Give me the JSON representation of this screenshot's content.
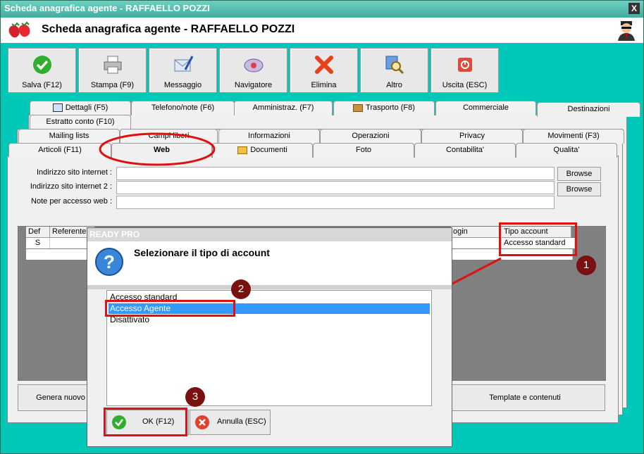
{
  "window": {
    "title": "Scheda anagrafica agente - RAFFAELLO POZZI",
    "close_label": "X"
  },
  "header": {
    "title": "Scheda anagrafica agente - RAFFAELLO POZZI",
    "logo_icon": "strawberry-icon",
    "agent_icon": "agent-avatar-icon"
  },
  "toolbar": [
    {
      "label": "Salva (F12)",
      "icon": "check-icon"
    },
    {
      "label": "Stampa (F9)",
      "icon": "printer-icon"
    },
    {
      "label": "Messaggio",
      "icon": "message-icon"
    },
    {
      "label": "Navigatore",
      "icon": "compass-icon"
    },
    {
      "label": "Elimina",
      "icon": "delete-icon"
    },
    {
      "label": "Altro",
      "icon": "search-icon"
    },
    {
      "label": "Uscita (ESC)",
      "icon": "exit-icon"
    }
  ],
  "tabs": {
    "row1": [
      "Dettagli (F5)",
      "Telefono/note (F6)",
      "Amministraz. (F7)",
      "Trasporto (F8)",
      "Commerciale",
      "Destinazioni"
    ],
    "row2": [
      "Estratto conto (F10)"
    ],
    "row3": [
      "Mailing lists",
      "Campi liberi",
      "Informazioni",
      "Operazioni",
      "Privacy",
      "Movimenti (F3)"
    ],
    "row4": [
      "Articoli (F11)",
      "Web",
      "Documenti",
      "Foto",
      "Contabilita'",
      "Qualita'"
    ],
    "active": "Web"
  },
  "form": {
    "site_label": "Indirizzo sito internet :",
    "site_value": "",
    "site2_label": "Indirizzo sito internet 2 :",
    "site2_value": "",
    "notes_label": "Note per accesso web :",
    "notes_value": "",
    "browse_label": "Browse"
  },
  "grid": {
    "headers": [
      "Def",
      "Referente",
      "ogin",
      "Tipo account"
    ],
    "row": {
      "def": "S",
      "tipo_account": "Accesso standard"
    }
  },
  "bottom_buttons": {
    "genera": "Genera nuovo",
    "template": "Template e contenuti"
  },
  "dialog": {
    "title": "READY PRO",
    "message": "Selezionare il tipo di account",
    "options": [
      "Accesso standard",
      "Accesso Agente",
      "Disattivato"
    ],
    "selected_index": 1,
    "ok_label": "OK (F12)",
    "cancel_label": "Annulla (ESC)"
  },
  "annotations": {
    "badges": [
      "1",
      "2",
      "3"
    ],
    "highlight_color": "#e01010",
    "badge_color": "#7a1010"
  },
  "colors": {
    "title_bar": "#45ab9c",
    "selection": "#3399ff"
  }
}
